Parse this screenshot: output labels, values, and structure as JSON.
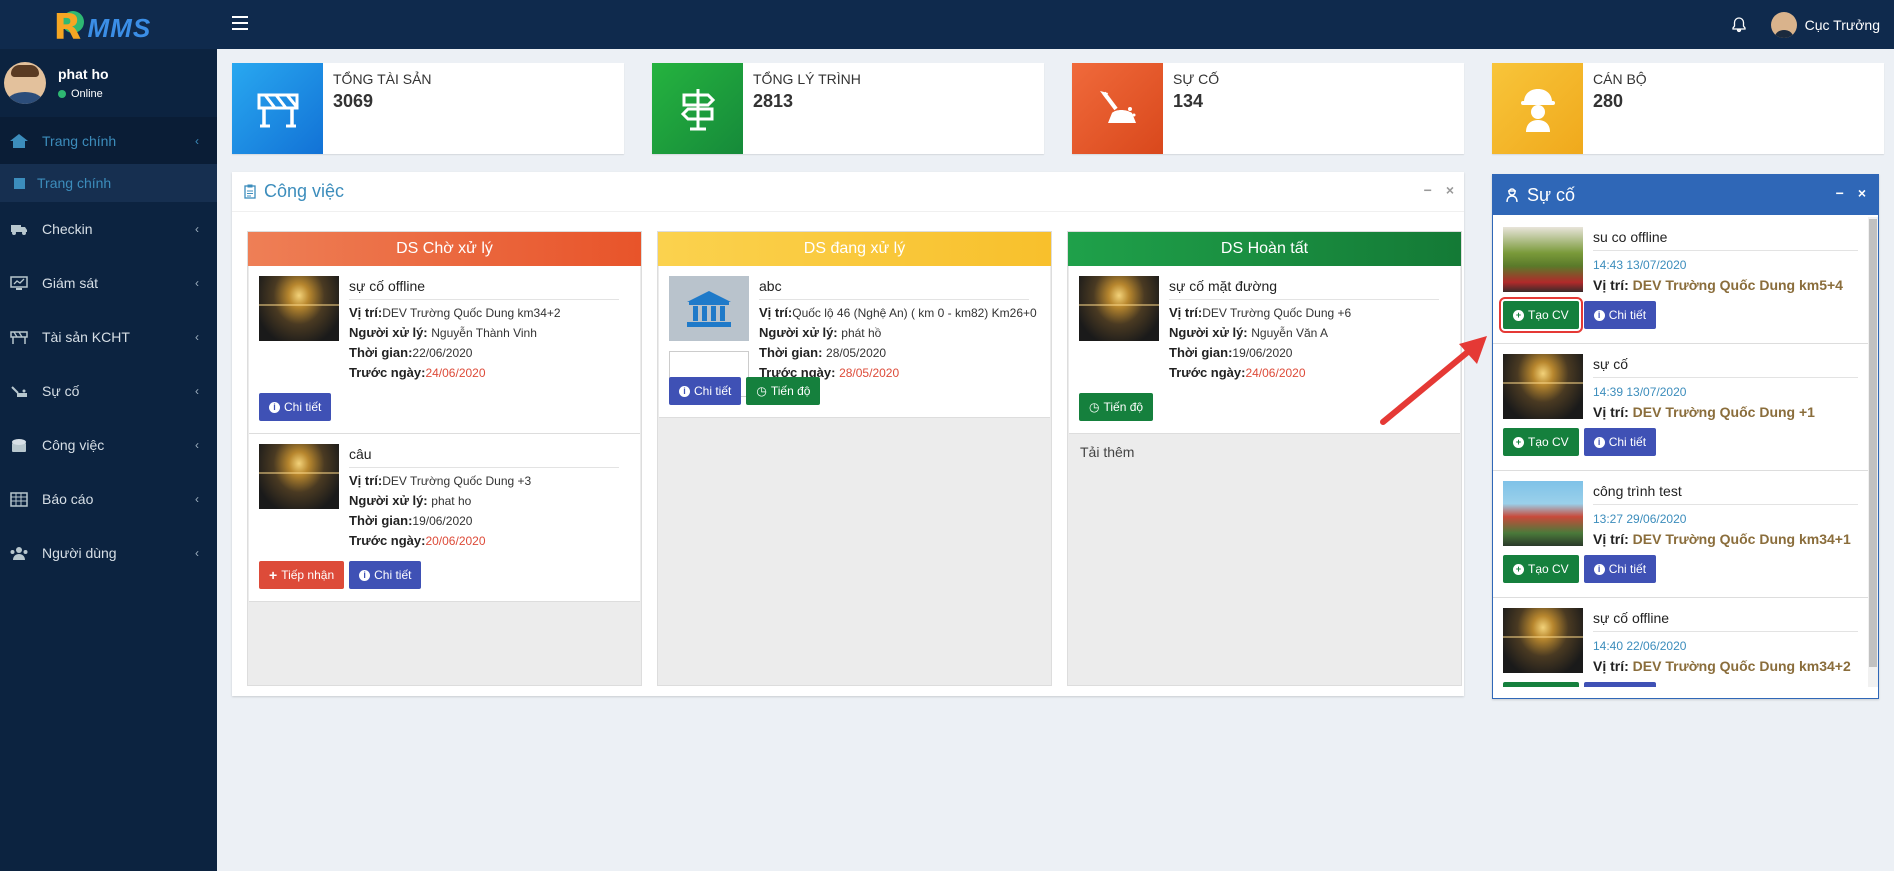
{
  "app": {
    "logo_text": "MMS"
  },
  "topbar": {
    "user_name": "Cục Trưởng"
  },
  "sidebar": {
    "user": {
      "name": "phat ho",
      "status": "Online"
    },
    "items": [
      {
        "label": "Trang chính",
        "icon": "home-icon",
        "active": true
      },
      {
        "label": "Checkin",
        "icon": "truck-icon"
      },
      {
        "label": "Giám sát",
        "icon": "monitor-icon"
      },
      {
        "label": "Tài sản KCHT",
        "icon": "barrier-icon"
      },
      {
        "label": "Sự cố",
        "icon": "excavator-icon"
      },
      {
        "label": "Công việc",
        "icon": "box-icon"
      },
      {
        "label": "Báo cáo",
        "icon": "table-icon"
      },
      {
        "label": "Người dùng",
        "icon": "users-icon"
      }
    ],
    "submenu": [
      {
        "label": "Trang chính"
      }
    ]
  },
  "stats": [
    {
      "label": "TỔNG TÀI SẢN",
      "value": "3069",
      "color": "#1e90e6",
      "icon": "barrier-icon"
    },
    {
      "label": "TỔNG LÝ TRÌNH",
      "value": "2813",
      "color": "#1e9e3a",
      "icon": "signpost-icon"
    },
    {
      "label": "SỰ CỐ",
      "value": "134",
      "color": "#e8542a",
      "icon": "excavator-icon"
    },
    {
      "label": "CÁN BỘ",
      "value": "280",
      "color": "#f5b82e",
      "icon": "worker-icon"
    }
  ],
  "work_panel": {
    "title": "Công việc",
    "columns": [
      {
        "title": "DS Chờ xử lý",
        "color": "#e8542a",
        "cards": [
          {
            "title": "sự cố offline",
            "location": "DEV Trường Quốc Dung km34+2",
            "handler": "Nguyễn Thành Vinh",
            "time": "22/06/2020",
            "deadline": "24/06/2020"
          },
          {
            "title": "câu",
            "location": "DEV Trường Quốc Dung +3",
            "handler": "phat ho",
            "time": "19/06/2020",
            "deadline": "20/06/2020"
          }
        ]
      },
      {
        "title": "DS đang xử lý",
        "color": "#f8c02c",
        "cards": [
          {
            "title": "abc",
            "location": "Quốc lộ 46 (Nghệ An) ( km 0 - km82) Km26+0",
            "handler": "phát hồ",
            "time": "28/05/2020",
            "deadline": "28/05/2020"
          }
        ]
      },
      {
        "title": "DS Hoàn tất",
        "color": "#168a3a",
        "cards": [
          {
            "title": "sự cố mặt đường",
            "location": "DEV Trường Quốc Dung +6",
            "handler": "Nguyễn Văn A",
            "time": "19/06/2020",
            "deadline": "24/06/2020"
          }
        ]
      }
    ],
    "labels": {
      "location": "Vị trí:",
      "handler": "Người xử lý:",
      "time": "Thời gian:",
      "deadline": "Trước ngày:",
      "detail": "Chi tiết",
      "accept": "Tiếp nhận",
      "progress": "Tiến độ",
      "load_more": "Tải thêm"
    }
  },
  "incident_panel": {
    "title": "Sự cố",
    "labels": {
      "create": "Tạo CV",
      "detail": "Chi tiết",
      "location": "Vị trí:"
    },
    "items": [
      {
        "title": "su co offline",
        "time": "14:43 13/07/2020",
        "location": "DEV Trường Quốc Dung km5+4"
      },
      {
        "title": "sự cố",
        "time": "14:39 13/07/2020",
        "location": "DEV Trường Quốc Dung +1"
      },
      {
        "title": "công trình test",
        "time": "13:27 29/06/2020",
        "location": "DEV Trường Quốc Dung km34+1"
      },
      {
        "title": "sự cố offline",
        "time": "14:40 22/06/2020",
        "location": "DEV Trường Quốc Dung km34+2"
      }
    ]
  }
}
